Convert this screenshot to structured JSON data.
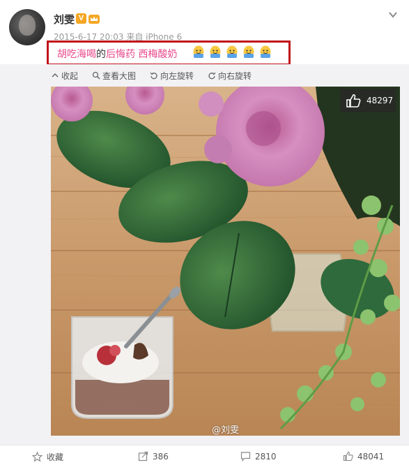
{
  "post": {
    "username": "刘雯",
    "verified_badge": "V",
    "crown_icon": "crown-icon",
    "meta": "2015-6-17 20:03 来自 iPhone 6",
    "text_plain": "胡吃海喝的后悔药",
    "text_link": "西梅酸奶",
    "text_link_prefix": "胡吃海喝",
    "text_connector": "的",
    "text_suffix_pink": "后悔药",
    "emoji_count": 5,
    "highlight_color": "#c0141b",
    "link_color": "#e9468a"
  },
  "toolbar": {
    "collapse": "收起",
    "view_large": "查看大图",
    "rotate_left": "向左旋转",
    "rotate_right": "向右旋转"
  },
  "image": {
    "likes": "48297",
    "watermark": "@刘雯"
  },
  "footer": {
    "favorite": "收藏",
    "repost_count": "386",
    "comment_count": "2810",
    "like_count": "48041"
  }
}
